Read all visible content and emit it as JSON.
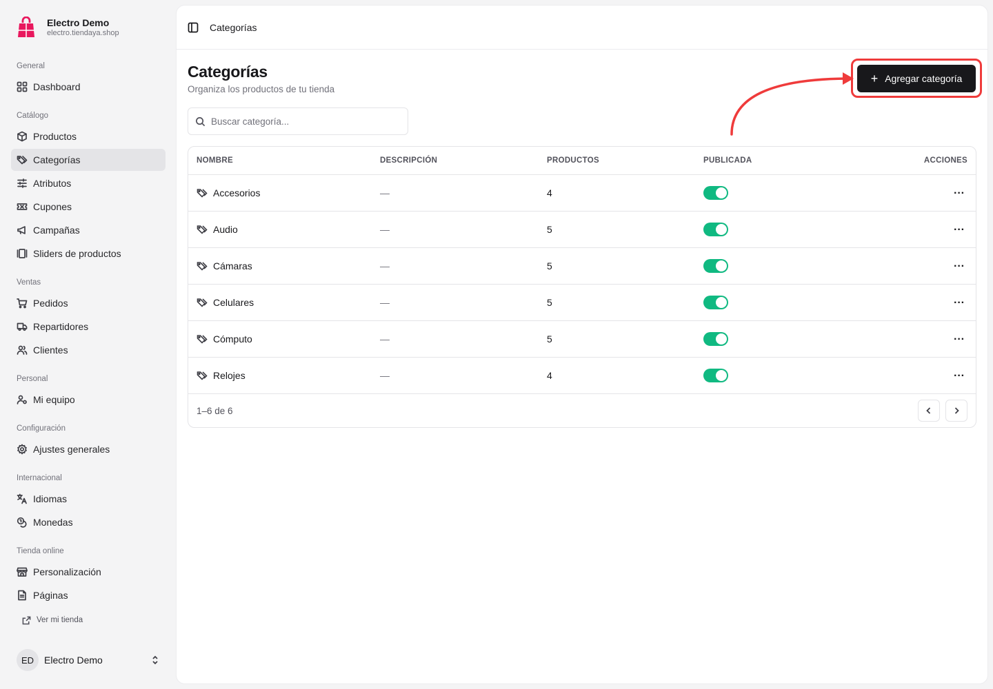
{
  "brand": {
    "name": "Electro Demo",
    "url": "electro.tiendaya.shop",
    "logo_color": "#e8175d"
  },
  "sidebar": {
    "groups": [
      {
        "label": "General",
        "items": [
          {
            "label": "Dashboard",
            "icon": "dashboard-icon"
          }
        ]
      },
      {
        "label": "Catálogo",
        "items": [
          {
            "label": "Productos",
            "icon": "box-icon"
          },
          {
            "label": "Categorías",
            "icon": "tag-icon",
            "active": true
          },
          {
            "label": "Atributos",
            "icon": "sliders-icon"
          },
          {
            "label": "Cupones",
            "icon": "ticket-icon"
          },
          {
            "label": "Campañas",
            "icon": "megaphone-icon"
          },
          {
            "label": "Sliders de productos",
            "icon": "gallery-icon"
          }
        ]
      },
      {
        "label": "Ventas",
        "items": [
          {
            "label": "Pedidos",
            "icon": "cart-icon"
          },
          {
            "label": "Repartidores",
            "icon": "truck-icon"
          },
          {
            "label": "Clientes",
            "icon": "users-icon"
          }
        ]
      },
      {
        "label": "Personal",
        "items": [
          {
            "label": "Mi equipo",
            "icon": "team-icon"
          }
        ]
      },
      {
        "label": "Configuración",
        "items": [
          {
            "label": "Ajustes generales",
            "icon": "gear-icon"
          }
        ]
      },
      {
        "label": "Internacional",
        "items": [
          {
            "label": "Idiomas",
            "icon": "language-icon"
          },
          {
            "label": "Monedas",
            "icon": "coins-icon"
          }
        ]
      },
      {
        "label": "Tienda online",
        "items": [
          {
            "label": "Personalización",
            "icon": "store-icon"
          },
          {
            "label": "Páginas",
            "icon": "file-icon"
          }
        ]
      }
    ],
    "store_link": "Ver mi tienda",
    "user": {
      "initials": "ED",
      "name": "Electro Demo"
    }
  },
  "topbar": {
    "breadcrumb": "Categorías"
  },
  "page": {
    "title": "Categorías",
    "subtitle": "Organiza los productos de tu tienda",
    "add_button": "Agregar categoría",
    "search_placeholder": "Buscar categoría..."
  },
  "table": {
    "headers": [
      "NOMBRE",
      "DESCRIPCIÓN",
      "PRODUCTOS",
      "PUBLICADA",
      "ACCIONES"
    ],
    "rows": [
      {
        "name": "Accesorios",
        "description": "—",
        "products": "4",
        "published": true
      },
      {
        "name": "Audio",
        "description": "—",
        "products": "5",
        "published": true
      },
      {
        "name": "Cámaras",
        "description": "—",
        "products": "5",
        "published": true
      },
      {
        "name": "Celulares",
        "description": "—",
        "products": "5",
        "published": true
      },
      {
        "name": "Cómputo",
        "description": "—",
        "products": "5",
        "published": true
      },
      {
        "name": "Relojes",
        "description": "—",
        "products": "4",
        "published": true
      }
    ],
    "pagination": "1–6 de 6",
    "actions_label": "···"
  },
  "colors": {
    "accent": "#18181b",
    "toggle_on": "#10b981",
    "annotation": "#ef3b3b"
  }
}
